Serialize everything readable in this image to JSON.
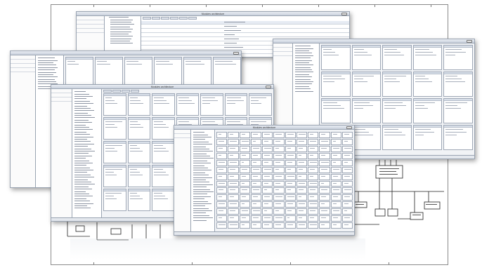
{
  "windows": {
    "top": {
      "title": "Modules architecture"
    },
    "mid": {
      "title": "Modules architecture"
    },
    "bottom": {
      "title": "Modules architecture"
    }
  },
  "icons": {
    "close": "close-icon",
    "tree": "tree-item-icon"
  },
  "colors": {
    "titlebar": "#c8d0dc",
    "panel": "#f1f3f6",
    "border": "#9aa4b2",
    "selection": "#3b6fcf"
  }
}
